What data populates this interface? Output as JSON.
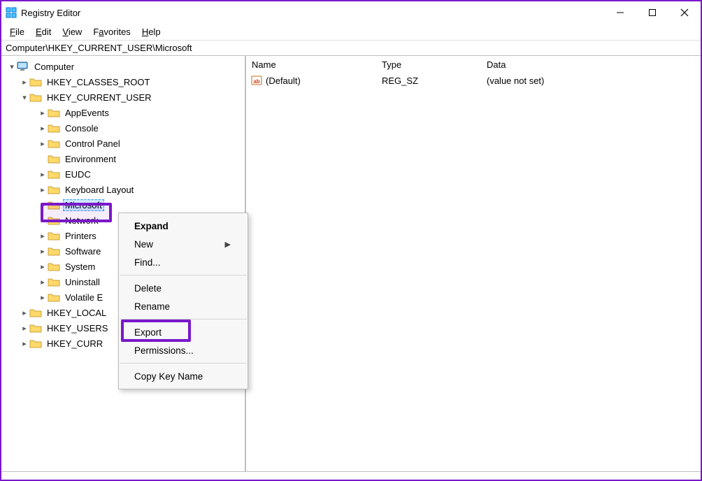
{
  "window": {
    "title": "Registry Editor",
    "icon": "regedit-icon"
  },
  "menubar": {
    "file": "File",
    "edit": "Edit",
    "view": "View",
    "favorites": "Favorites",
    "help": "Help"
  },
  "path": "Computer\\HKEY_CURRENT_USER\\Microsoft",
  "tree": {
    "root": {
      "label": "Computer",
      "expanded": true
    },
    "hives": [
      {
        "label": "HKEY_CLASSES_ROOT",
        "expanded": false
      },
      {
        "label": "HKEY_CURRENT_USER",
        "expanded": true,
        "children": [
          {
            "label": "AppEvents",
            "expandable": true
          },
          {
            "label": "Console",
            "expandable": true
          },
          {
            "label": "Control Panel",
            "expandable": true
          },
          {
            "label": "Environment",
            "expandable": false
          },
          {
            "label": "EUDC",
            "expandable": true
          },
          {
            "label": "Keyboard Layout",
            "expandable": true
          },
          {
            "label": "Microsoft",
            "expandable": true,
            "selected": true
          },
          {
            "label": "Network",
            "expandable": true
          },
          {
            "label": "Printers",
            "expandable": true
          },
          {
            "label": "Software",
            "expandable": true
          },
          {
            "label": "System",
            "expandable": true
          },
          {
            "label": "Uninstall",
            "expandable": true
          },
          {
            "label": "Volatile E",
            "expandable": true
          }
        ]
      },
      {
        "label": "HKEY_LOCAL",
        "expanded": false
      },
      {
        "label": "HKEY_USERS",
        "expanded": false
      },
      {
        "label": "HKEY_CURR",
        "expanded": false
      }
    ]
  },
  "list": {
    "columns": {
      "name": "Name",
      "type": "Type",
      "data": "Data"
    },
    "rows": [
      {
        "name": "(Default)",
        "type": "REG_SZ",
        "data": "(value not set)",
        "icon": "string-value-icon"
      }
    ]
  },
  "context_menu": {
    "items": [
      {
        "label": "Expand",
        "bold": true
      },
      {
        "label": "New",
        "submenu": true
      },
      {
        "label": "Find..."
      },
      {
        "sep": true
      },
      {
        "label": "Delete"
      },
      {
        "label": "Rename"
      },
      {
        "sep": true
      },
      {
        "label": "Export",
        "highlight": true
      },
      {
        "label": "Permissions..."
      },
      {
        "sep": true
      },
      {
        "label": "Copy Key Name"
      }
    ]
  },
  "highlights": {
    "microsoft_node": true,
    "export_item": true
  }
}
